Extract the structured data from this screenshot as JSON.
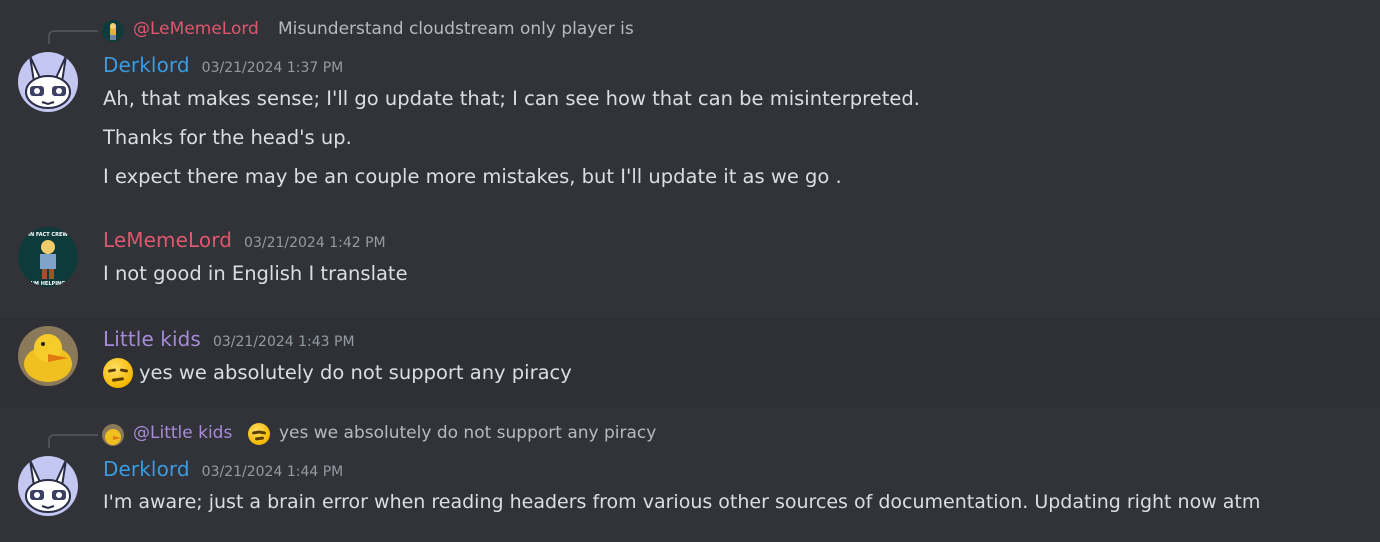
{
  "colors": {
    "background": "#313338",
    "hover_background": "#2e3035",
    "derklord": "#3b9be0",
    "lememelord": "#e0566f",
    "little_kids": "#a88bd8",
    "text": "#dbdee1",
    "muted": "#949ba4"
  },
  "messages": [
    {
      "reply": {
        "mention": "@LeMemeLord",
        "text": "Misunderstand cloudstream only player is"
      },
      "author": "Derklord",
      "timestamp": "03/21/2024 1:37 PM",
      "lines": [
        "Ah, that makes sense; I'll go update that; I can see how that can be misinterpreted.",
        "Thanks for the head's up.",
        "I expect there may be an couple more mistakes, but I'll update it as we go ."
      ]
    },
    {
      "author": "LeMemeLord",
      "timestamp": "03/21/2024 1:42 PM",
      "lines": [
        "I not good in English I translate"
      ]
    },
    {
      "author": "Little kids",
      "timestamp": "03/21/2024 1:43 PM",
      "emoji": "raised-eyebrow-emoji",
      "lines": [
        "yes we absolutely do not support any piracy"
      ]
    },
    {
      "reply": {
        "mention": "@Little kids",
        "emoji": "raised-eyebrow-emoji",
        "text": "yes we absolutely do not support any piracy"
      },
      "author": "Derklord",
      "timestamp": "03/21/2024 1:44 PM",
      "lines": [
        "I'm aware; just a brain error when reading headers from various other sources of documentation. Updating right now atm"
      ]
    }
  ]
}
